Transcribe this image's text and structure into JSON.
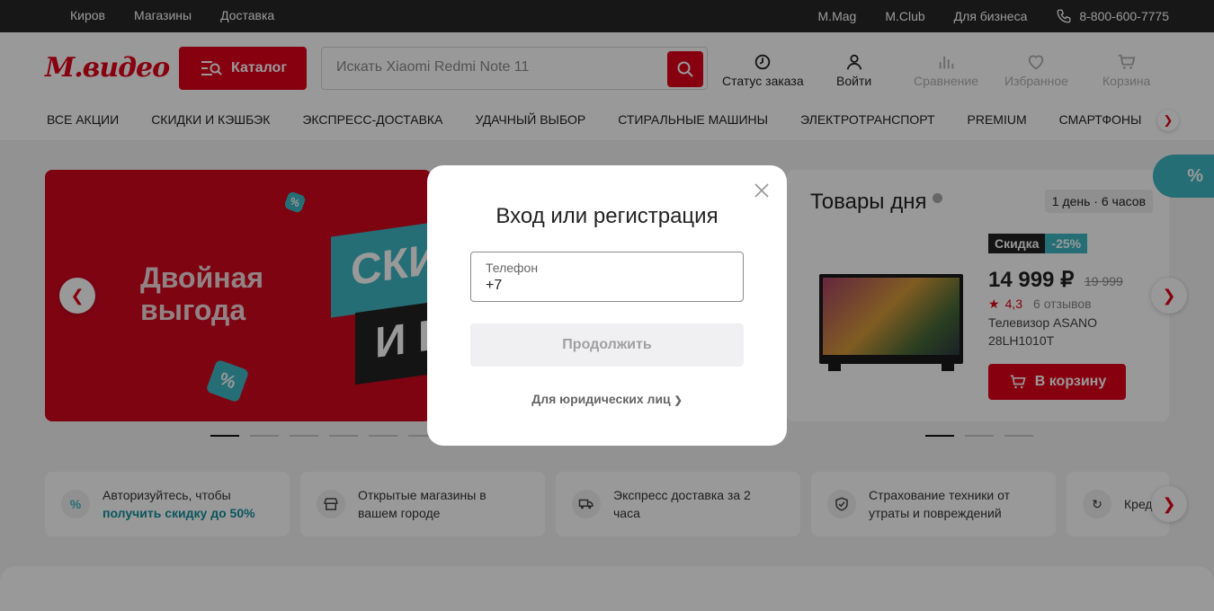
{
  "topbar": {
    "city": "Киров",
    "stores": "Магазины",
    "delivery": "Доставка",
    "mmag": "M.Mag",
    "mclub": "M.Club",
    "business": "Для бизнеса",
    "phone": "8-800-600-7775"
  },
  "header": {
    "logo": "М.видео",
    "catalog_label": "Каталог",
    "search_placeholder": "Искать Xiaomi Redmi Note 11",
    "actions": {
      "order_status": "Статус заказа",
      "login": "Войти",
      "compare": "Сравнение",
      "favorites": "Избранное",
      "cart": "Корзина"
    }
  },
  "nav": [
    "ВСЕ АКЦИИ",
    "СКИДКИ И КЭШБЭК",
    "ЭКСПРЕСС-ДОСТАВКА",
    "УДАЧНЫЙ ВЫБОР",
    "СТИРАЛЬНЫЕ МАШИНЫ",
    "ЭЛЕКТРОТРАНСПОРТ",
    "PREMIUM",
    "СМАРТФОНЫ"
  ],
  "banner": {
    "line1": "Двойная",
    "line2": "выгода",
    "tile1": "СКИ",
    "tile2": "И К",
    "pct": "%"
  },
  "deals": {
    "title": "Товары дня",
    "timer": "1 день · 6 часов",
    "badge": "Скидка",
    "discount": "-25%",
    "price": "14 999 ₽",
    "old_price": "19 999",
    "rating": "4,3",
    "reviews": "6 отзывов",
    "product_name": "Телевизор ASANO 28LH1010T",
    "cart_label": "В корзину"
  },
  "features": [
    {
      "text": "Авторизуйтесь, чтобы",
      "link": "получить скидку до 50%"
    },
    {
      "text": "Открытые магазины в вашем городе"
    },
    {
      "text": "Экспресс доставка за 2 часа"
    },
    {
      "text": "Страхование техники от утраты и повреждений"
    },
    {
      "text": "Кред"
    }
  ],
  "modal": {
    "title": "Вход или регистрация",
    "phone_label": "Телефон",
    "phone_value": "+7",
    "continue_label": "Продолжить",
    "legal_link": "Для юридических лиц"
  },
  "colors": {
    "brand": "#e2001a",
    "accent": "#3fb8c4",
    "topbar": "#272727"
  }
}
